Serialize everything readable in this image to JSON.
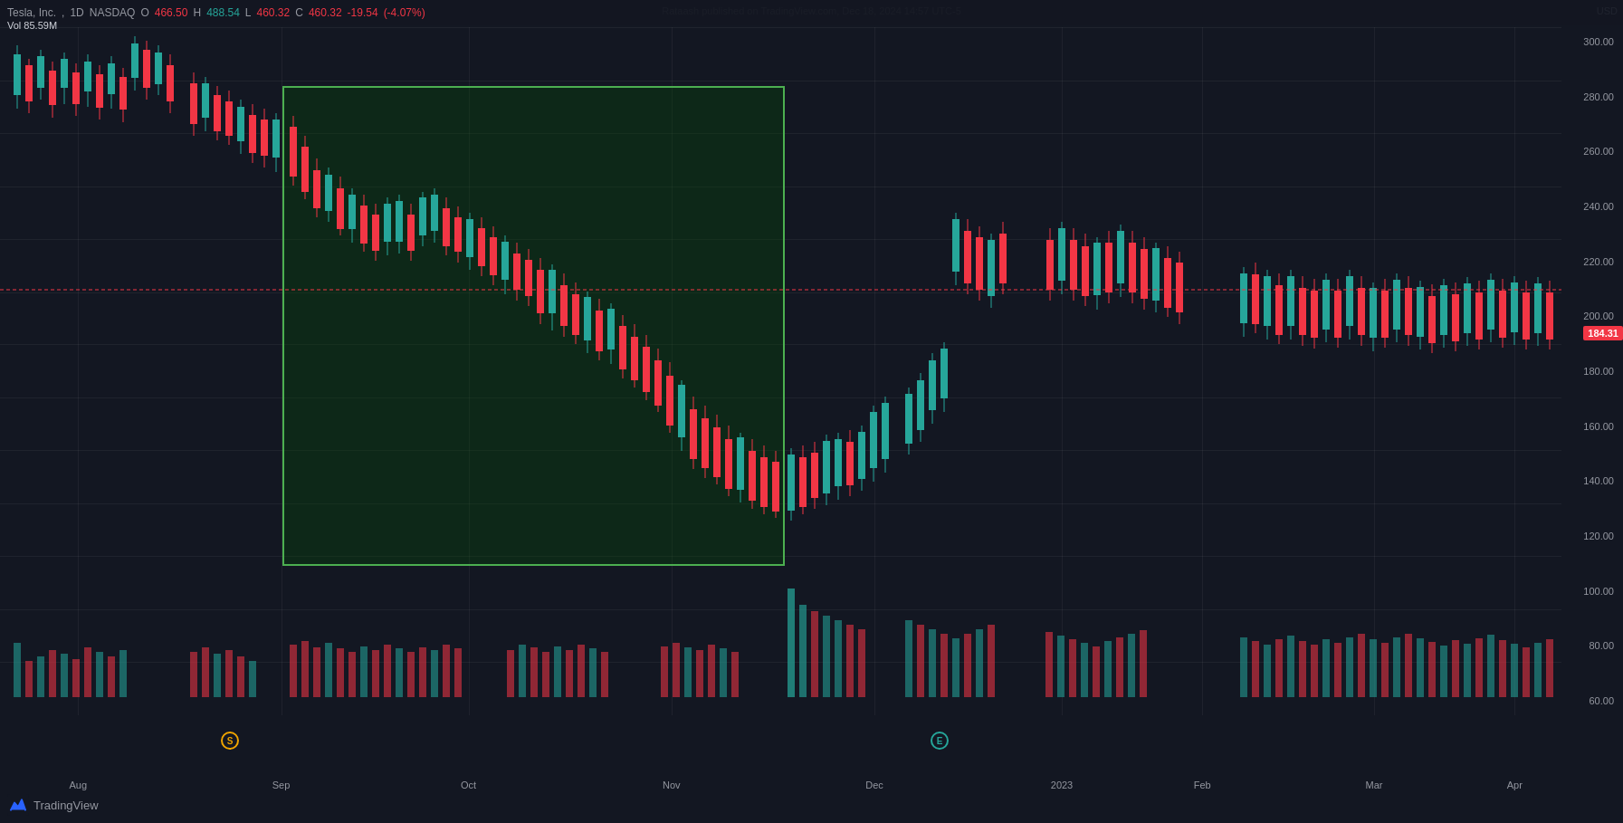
{
  "watermark": "Rataash published on TradingView.com, Dec 18, 2024 14:57 UTC-5",
  "stock": {
    "name": "Tesla, Inc.",
    "interval": "1D",
    "exchange": "NASDAQ",
    "open_label": "O",
    "open_value": "466.50",
    "high_label": "H",
    "high_value": "488.54",
    "low_label": "L",
    "low_value": "460.32",
    "close_label": "C",
    "close_value": "460.32",
    "change": "-19.54",
    "change_pct": "(-4.07%)",
    "vol_label": "Vol",
    "vol_value": "85.59M"
  },
  "price_axis": {
    "currency": "USD",
    "levels": [
      "300.00",
      "280.00",
      "260.00",
      "240.00",
      "220.00",
      "200.00",
      "180.00",
      "160.00",
      "140.00",
      "120.00",
      "100.00",
      "80.00",
      "60.00"
    ]
  },
  "current_price": "184.31",
  "time_labels": [
    {
      "label": "Aug",
      "pct": 5
    },
    {
      "label": "Sep",
      "pct": 18
    },
    {
      "label": "Oct",
      "pct": 30
    },
    {
      "label": "Nov",
      "pct": 43
    },
    {
      "label": "Dec",
      "pct": 56
    },
    {
      "label": "2023",
      "pct": 68
    },
    {
      "label": "Feb",
      "pct": 77
    },
    {
      "label": "Mar",
      "pct": 88
    },
    {
      "label": "Apr",
      "pct": 97
    }
  ],
  "tv_logo_text": "TradingView",
  "s_marker": "S",
  "e_marker": "E"
}
